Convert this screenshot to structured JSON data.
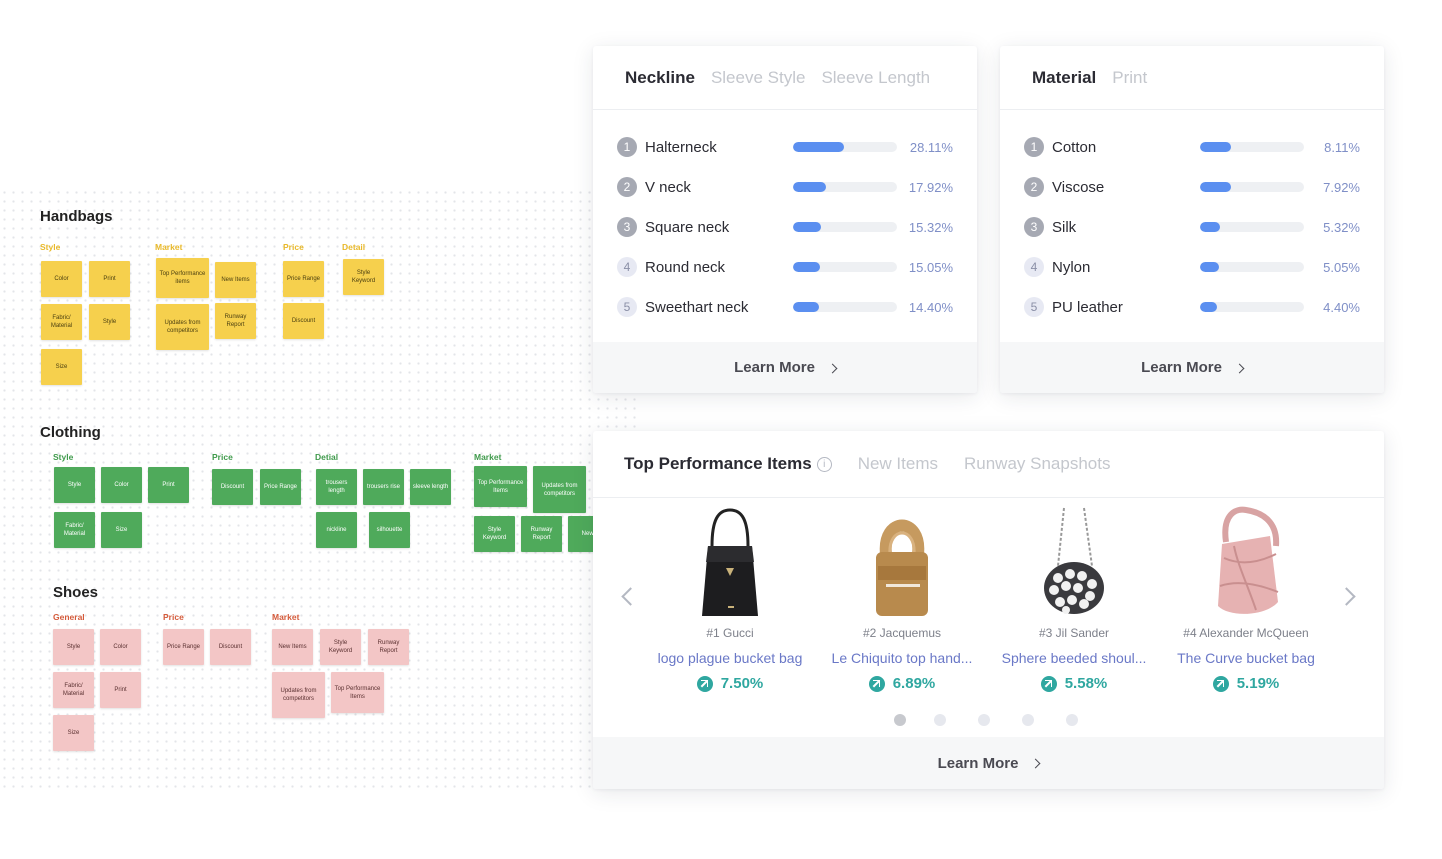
{
  "board": {
    "handbags": {
      "title": "Handbags",
      "columns": {
        "style": "Style",
        "market": "Market",
        "price": "Price",
        "detail": "Detail"
      },
      "notes": [
        "Color",
        "Print",
        "Fabric/ Material",
        "Style",
        "Size",
        "Top Performance items",
        "New Items",
        "Updates from competitors",
        "Runway Report",
        "Price Range",
        "Discount",
        "Style Keyword"
      ]
    },
    "clothing": {
      "title": "Clothing",
      "columns": {
        "style": "Style",
        "price": "Price",
        "detial": "Detial",
        "market": "Market"
      },
      "notes": [
        "Style",
        "Color",
        "Print",
        "Fabric/ Material",
        "Size",
        "Discount",
        "Price Range",
        "trousers length",
        "trousers rise",
        "sleeve length",
        "nickline",
        "silhouette",
        "Top Performance Items",
        "Updates from competitors",
        "Style Keyword",
        "Runway Report",
        "New Item"
      ]
    },
    "shoes": {
      "title": "Shoes",
      "columns": {
        "general": "General",
        "price": "Price",
        "market": "Market"
      },
      "notes": [
        "Style",
        "Color",
        "Fabric/ Material",
        "Print",
        "Size",
        "Price Range",
        "Discount",
        "New Items",
        "Style Keyword",
        "Runway Report",
        "Updates from competitors",
        "Top Performance Items"
      ]
    }
  },
  "neckline_card": {
    "tabs": [
      "Neckline",
      "Sleeve Style",
      "Sleeve Length"
    ],
    "rows": [
      {
        "rank": "1",
        "label": "Halterneck",
        "pct": "28.11%",
        "value": 28.11
      },
      {
        "rank": "2",
        "label": "V neck",
        "pct": "17.92%",
        "value": 17.92
      },
      {
        "rank": "3",
        "label": "Square neck",
        "pct": "15.32%",
        "value": 15.32
      },
      {
        "rank": "4",
        "label": "Round neck",
        "pct": "15.05%",
        "value": 15.05
      },
      {
        "rank": "5",
        "label": "Sweethart neck",
        "pct": "14.40%",
        "value": 14.4
      }
    ],
    "learn_more": "Learn More"
  },
  "material_card": {
    "tabs": [
      "Material",
      "Print"
    ],
    "rows": [
      {
        "rank": "1",
        "label": "Cotton",
        "pct": "8.11%",
        "value": 8.11
      },
      {
        "rank": "2",
        "label": "Viscose",
        "pct": "7.92%",
        "value": 7.92
      },
      {
        "rank": "3",
        "label": "Silk",
        "pct": "5.32%",
        "value": 5.32
      },
      {
        "rank": "4",
        "label": "Nylon",
        "pct": "5.05%",
        "value": 5.05
      },
      {
        "rank": "5",
        "label": "PU leather",
        "pct": "4.40%",
        "value": 4.4
      }
    ],
    "learn_more": "Learn More"
  },
  "top_items_card": {
    "tabs": [
      "Top Performance Items",
      "New Items",
      "Runway Snapshots"
    ],
    "info_icon": "info-icon",
    "products": [
      {
        "rank": "#1 Gucci",
        "name": "logo plague bucket bag",
        "growth": "7.50%"
      },
      {
        "rank": "#2 Jacquemus",
        "name": "Le Chiquito top hand...",
        "growth": "6.89%"
      },
      {
        "rank": "#3 Jil Sander",
        "name": "Sphere beeded shoul...",
        "growth": "5.58%"
      },
      {
        "rank": "#4 Alexander McQueen",
        "name": "The Curve bucket bag",
        "growth": "5.19%"
      }
    ],
    "pagination": {
      "pages": 5,
      "current": 1
    },
    "learn_more": "Learn More"
  },
  "colors": {
    "accent_bar": "#5b8ff0",
    "growth": "#2fa7a0",
    "pct_text": "#7f8fc7"
  }
}
